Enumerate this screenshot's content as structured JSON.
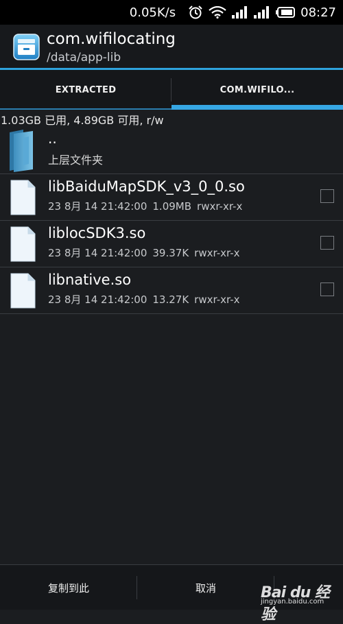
{
  "status_bar": {
    "network_speed": "0.05K/s",
    "time": "08:27",
    "icons": [
      "alarm-icon",
      "wifi-icon",
      "signal-icon",
      "signal-icon",
      "battery-icon"
    ]
  },
  "header": {
    "title": "com.wifilocating",
    "subtitle": "/data/app-lib"
  },
  "tabs": [
    {
      "label": "EXTRACTED"
    },
    {
      "label": "COM.WIFILO..."
    }
  ],
  "storage": {
    "info": "1.03GB 已用, 4.89GB 可用, r/w"
  },
  "parent_folder": {
    "name": "..",
    "label": "上层文件夹"
  },
  "files": [
    {
      "name": "libBaiduMapSDK_v3_0_0.so",
      "date": "23 8月 14 21:42:00",
      "size": "1.09MB",
      "perm": "rwxr-xr-x"
    },
    {
      "name": "liblocSDK3.so",
      "date": "23 8月 14 21:42:00",
      "size": "39.37K",
      "perm": "rwxr-xr-x"
    },
    {
      "name": "libnative.so",
      "date": "23 8月 14 21:42:00",
      "size": "13.27K",
      "perm": "rwxr-xr-x"
    }
  ],
  "bottom_bar": {
    "copy_here": "复制到此",
    "cancel": "取消"
  },
  "watermark": {
    "brand": "Bai du 经验",
    "url": "jingyan.baidu.com"
  },
  "colors": {
    "accent": "#36a7e4",
    "background": "#1b1d20",
    "divider": "#3a3d42"
  }
}
